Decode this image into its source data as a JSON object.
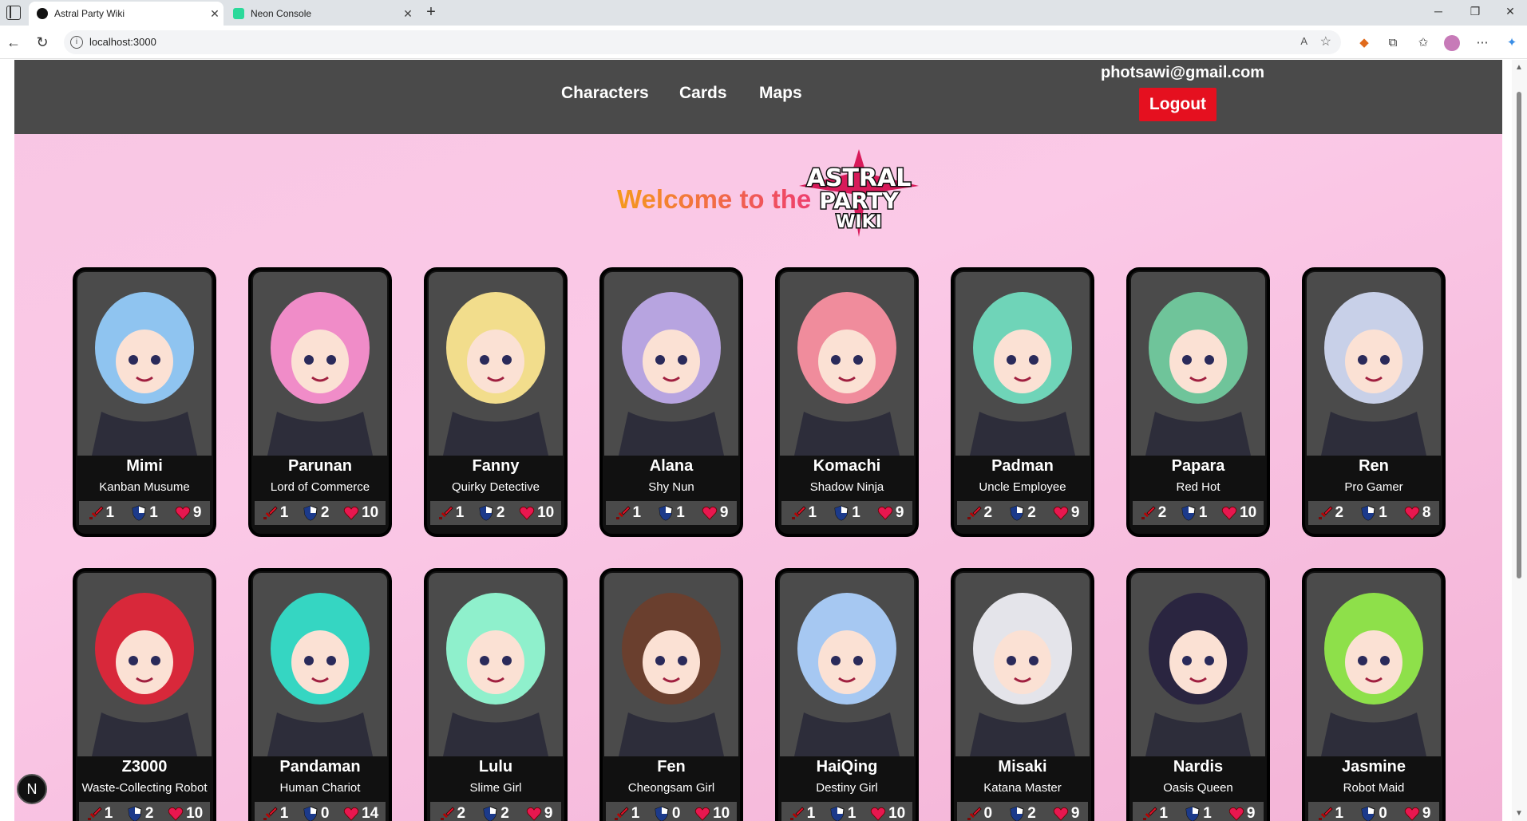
{
  "browser": {
    "tabs": [
      {
        "title": "Astral Party Wiki",
        "active": true
      },
      {
        "title": "Neon Console",
        "active": false
      }
    ],
    "url": "localhost:3000",
    "window_controls": [
      "minimize-icon",
      "restore-icon",
      "close-icon"
    ]
  },
  "header": {
    "nav": [
      "Characters",
      "Cards",
      "Maps"
    ],
    "email": "photsawi@gmail.com",
    "logout_label": "Logout"
  },
  "hero": {
    "welcome": "Welcome to the",
    "logo_lines": [
      "ASTRAL",
      "PARTY",
      "WIKI"
    ]
  },
  "colors": {
    "header_bg": "#4a4a4a",
    "logout_bg": "#e5101f",
    "page_bg": "#f8c6e3",
    "attack": "#e0142a",
    "defense_dark": "#1c3a8a",
    "heart": "#e8174f"
  },
  "characters": [
    {
      "name": "Mimi",
      "title": "Kanban Musume",
      "atk": "1",
      "def": "1",
      "hp": "9",
      "hair": "#8fc4f0"
    },
    {
      "name": "Parunan",
      "title": "Lord of Commerce",
      "atk": "1",
      "def": "2",
      "hp": "10",
      "hair": "#f08cc8"
    },
    {
      "name": "Fanny",
      "title": "Quirky Detective",
      "atk": "1",
      "def": "2",
      "hp": "10",
      "hair": "#f2dd8c"
    },
    {
      "name": "Alana",
      "title": "Shy Nun",
      "atk": "1",
      "def": "1",
      "hp": "9",
      "hair": "#b7a4e0"
    },
    {
      "name": "Komachi",
      "title": "Shadow Ninja",
      "atk": "1",
      "def": "1",
      "hp": "9",
      "hair": "#f08c9c"
    },
    {
      "name": "Padman",
      "title": "Uncle Employee",
      "atk": "2",
      "def": "2",
      "hp": "9",
      "hair": "#6fd4b8"
    },
    {
      "name": "Papara",
      "title": "Red Hot",
      "atk": "2",
      "def": "1",
      "hp": "10",
      "hair": "#6fc49a"
    },
    {
      "name": "Ren",
      "title": "Pro Gamer",
      "atk": "2",
      "def": "1",
      "hp": "8",
      "hair": "#c8d0e8"
    },
    {
      "name": "Z3000",
      "title": "Waste-Collecting Robot",
      "atk": "1",
      "def": "2",
      "hp": "10",
      "hair": "#d8283a"
    },
    {
      "name": "Pandaman",
      "title": "Human Chariot",
      "atk": "1",
      "def": "0",
      "hp": "14",
      "hair": "#35d6c2"
    },
    {
      "name": "Lulu",
      "title": "Slime Girl",
      "atk": "2",
      "def": "2",
      "hp": "9",
      "hair": "#8ff0cc"
    },
    {
      "name": "Fen",
      "title": "Cheongsam Girl",
      "atk": "1",
      "def": "0",
      "hp": "10",
      "hair": "#6a3f2e"
    },
    {
      "name": "HaiQing",
      "title": "Destiny Girl",
      "atk": "1",
      "def": "1",
      "hp": "10",
      "hair": "#a6c8f2"
    },
    {
      "name": "Misaki",
      "title": "Katana Master",
      "atk": "0",
      "def": "2",
      "hp": "9",
      "hair": "#e4e4ea"
    },
    {
      "name": "Nardis",
      "title": "Oasis Queen",
      "atk": "1",
      "def": "1",
      "hp": "9",
      "hair": "#2a2540"
    },
    {
      "name": "Jasmine",
      "title": "Robot Maid",
      "atk": "1",
      "def": "0",
      "hp": "9",
      "hair": "#8ee04a"
    }
  ],
  "floating_button_label": "N"
}
